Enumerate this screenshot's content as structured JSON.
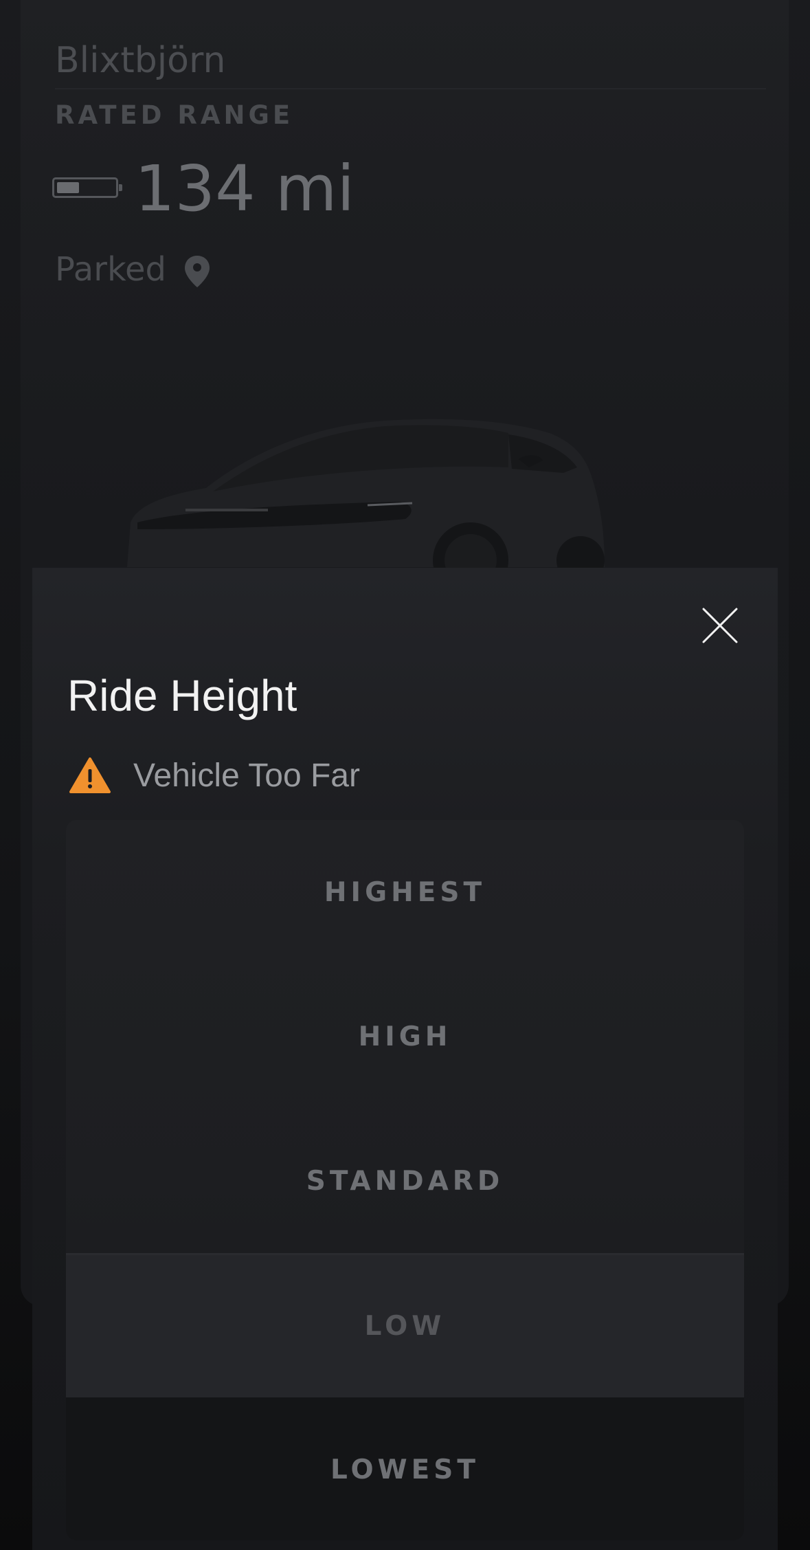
{
  "vehicle": {
    "name": "Blixtbjörn",
    "range_label": "RATED RANGE",
    "range_value": "134 mi",
    "status": "Parked",
    "battery_icon": "battery-icon",
    "location_icon": "location-pin-icon"
  },
  "modal": {
    "title": "Ride Height",
    "close_icon": "close-icon",
    "warning": {
      "icon": "warning-triangle-icon",
      "text": "Vehicle Too Far",
      "color": "#f0912e"
    },
    "options": [
      {
        "label": "HIGHEST"
      },
      {
        "label": "HIGH"
      },
      {
        "label": "STANDARD"
      },
      {
        "label": "LOW",
        "selected": true
      },
      {
        "label": "LOWEST"
      }
    ]
  }
}
